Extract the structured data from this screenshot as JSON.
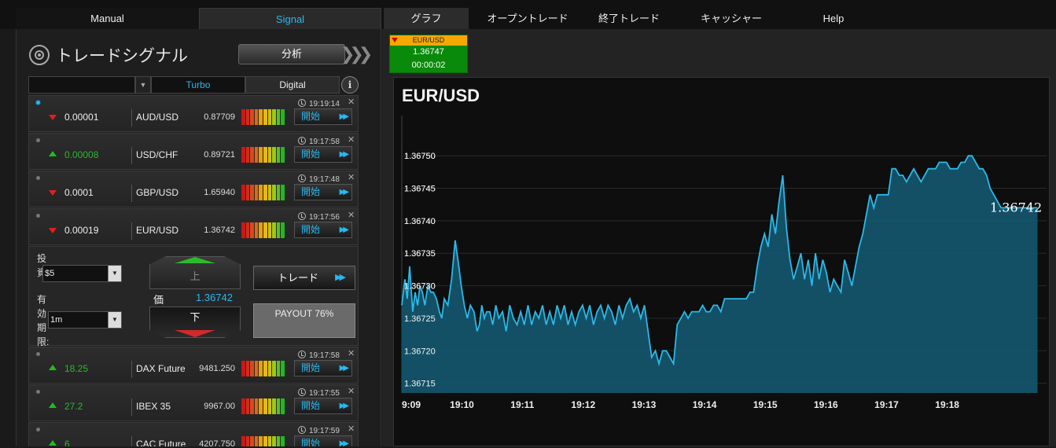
{
  "top_tabs": {
    "manual": "Manual",
    "signal": "Signal",
    "graph": "グラフ",
    "open_trades": "オープントレード",
    "closed_trades": "終了トレード",
    "cashier": "キャッシャー",
    "help": "Help"
  },
  "signals_panel": {
    "title": "トレードシグナル",
    "analysis_button": "分析",
    "filter": {
      "selected": "",
      "tab_turbo": "Turbo",
      "tab_digital": "Digital"
    },
    "open_label": "開始",
    "rows_before": [
      {
        "direction": "down",
        "change": "0.00001",
        "asset": "AUD/USD",
        "price": "0.87709",
        "time": "19:19:14",
        "active": true
      },
      {
        "direction": "up",
        "change": "0.00008",
        "asset": "USD/CHF",
        "price": "0.89721",
        "time": "19:17:58",
        "active": false
      },
      {
        "direction": "down",
        "change": "0.0001",
        "asset": "GBP/USD",
        "price": "1.65940",
        "time": "19:17:48",
        "active": false
      },
      {
        "direction": "down",
        "change": "0.00019",
        "asset": "EUR/USD",
        "price": "1.36742",
        "time": "19:17:56",
        "active": false
      }
    ],
    "rows_after": [
      {
        "direction": "up",
        "change": "18.25",
        "asset": "DAX Future",
        "price": "9481.250",
        "time": "19:17:58",
        "active": false
      },
      {
        "direction": "up",
        "change": "27.2",
        "asset": "IBEX 35",
        "price": "9967.00",
        "time": "19:17:55",
        "active": false
      },
      {
        "direction": "up",
        "change": "6",
        "asset": "CAC Future",
        "price": "4207.750",
        "time": "19:17:59",
        "active": false
      }
    ],
    "trade": {
      "invest_label": "投資:",
      "invest_value": "$5",
      "expiry_label": "有効期限:",
      "expiry_value": "1m",
      "up_label": "上",
      "down_label": "下",
      "price_label": "価",
      "price_value": "1.36742",
      "trade_button": "トレード",
      "payout": "PAYOUT 76%"
    }
  },
  "mini_card": {
    "asset": "EUR/USD",
    "price": "1.36747",
    "timer": "00:00:02",
    "direction": "down"
  },
  "colors": {
    "accent": "#29b7ef",
    "up": "#2bb82b",
    "down": "#d22222",
    "chart_fill": "#14546b",
    "chart_line": "#2cb8e8"
  },
  "chart_data": {
    "type": "area",
    "title": "EUR/USD",
    "current_value": "1.36742",
    "y_ticks": [
      "1.36750",
      "1.36745",
      "1.36740",
      "1.36735",
      "1.36730",
      "1.36725",
      "1.36720",
      "1.36715"
    ],
    "x_ticks": [
      "9:09",
      "19:10",
      "19:11",
      "19:12",
      "19:13",
      "19:14",
      "19:15",
      "19:16",
      "19:17",
      "19:18"
    ],
    "ylim": [
      1.367135,
      1.367545
    ],
    "x_range": [
      9.0,
      19.5
    ],
    "grid": true,
    "x": [
      9.0,
      9.05,
      9.09,
      9.13,
      9.18,
      9.22,
      9.26,
      9.3,
      9.34,
      9.38,
      9.43,
      9.48,
      9.52,
      9.57,
      9.62,
      9.66,
      9.7,
      9.76,
      9.82,
      9.88,
      9.94,
      9.98,
      10.03,
      10.08,
      10.13,
      10.19,
      10.24,
      10.28,
      10.32,
      10.36,
      10.4,
      10.45,
      10.5,
      10.55,
      10.6,
      10.66,
      10.72,
      10.78,
      10.84,
      10.9,
      10.96,
      11.02,
      11.08,
      11.14,
      11.2,
      11.26,
      11.32,
      11.38,
      11.44,
      11.5,
      11.56,
      11.62,
      11.68,
      11.74,
      11.8,
      11.86,
      11.92,
      11.98,
      12.04,
      12.1,
      12.16,
      12.22,
      12.28,
      12.34,
      12.4,
      12.46,
      12.52,
      12.58,
      12.64,
      12.7,
      12.76,
      12.82,
      12.88,
      12.94,
      13.0,
      13.06,
      13.12,
      13.18,
      13.24,
      13.3,
      13.36,
      13.42,
      13.48,
      13.54,
      13.6,
      13.66,
      13.72,
      13.78,
      13.84,
      13.9,
      13.96,
      14.02,
      14.08,
      14.14,
      14.2,
      14.26,
      14.32,
      14.38,
      14.44,
      14.5,
      14.56,
      14.62,
      14.68,
      14.74,
      14.8,
      14.86,
      14.92,
      14.98,
      15.04,
      15.1,
      15.16,
      15.22,
      15.28,
      15.34,
      15.4,
      15.46,
      15.52,
      15.58,
      15.64,
      15.7,
      15.76,
      15.82,
      15.88,
      15.94,
      16.0,
      16.06,
      16.12,
      16.18,
      16.24,
      16.3,
      16.36,
      16.42,
      16.48,
      16.54,
      16.6,
      16.66,
      16.72,
      16.78,
      16.84,
      16.9,
      16.96,
      17.02,
      17.08,
      17.14,
      17.2,
      17.26,
      17.32,
      17.38,
      17.44,
      17.5,
      17.56,
      17.62,
      17.68,
      17.74,
      17.8,
      17.86,
      17.92,
      17.98,
      18.04,
      18.1,
      18.16,
      18.22,
      18.28,
      18.34,
      18.4,
      18.46,
      18.52,
      18.58,
      18.64,
      18.7,
      18.76,
      18.82,
      18.88,
      18.94,
      19.0,
      19.06,
      19.12,
      19.18,
      19.24,
      19.3,
      19.36,
      19.42,
      19.48
    ],
    "values": [
      1.36727,
      1.36731,
      1.36728,
      1.36733,
      1.36726,
      1.36729,
      1.36727,
      1.3673,
      1.36729,
      1.36727,
      1.3673,
      1.36729,
      1.36729,
      1.36728,
      1.36726,
      1.36725,
      1.36728,
      1.36727,
      1.36731,
      1.36737,
      1.36733,
      1.3673,
      1.36727,
      1.36725,
      1.36727,
      1.36726,
      1.36723,
      1.36724,
      1.36727,
      1.36725,
      1.36726,
      1.36726,
      1.36724,
      1.36727,
      1.36725,
      1.36726,
      1.36723,
      1.36727,
      1.36725,
      1.36724,
      1.36726,
      1.36724,
      1.36727,
      1.36724,
      1.36726,
      1.36725,
      1.36727,
      1.36724,
      1.36726,
      1.36724,
      1.36727,
      1.36725,
      1.36727,
      1.36724,
      1.36726,
      1.36724,
      1.36726,
      1.36727,
      1.36725,
      1.36727,
      1.36724,
      1.36726,
      1.36727,
      1.36725,
      1.36727,
      1.36726,
      1.36724,
      1.36727,
      1.36725,
      1.36727,
      1.36728,
      1.36726,
      1.36727,
      1.36725,
      1.36727,
      1.36723,
      1.36719,
      1.3672,
      1.36718,
      1.3672,
      1.3672,
      1.36719,
      1.36718,
      1.36724,
      1.36725,
      1.36726,
      1.36725,
      1.36726,
      1.36726,
      1.36726,
      1.36727,
      1.36726,
      1.36726,
      1.36727,
      1.36727,
      1.36726,
      1.36728,
      1.36728,
      1.36728,
      1.36728,
      1.36728,
      1.36728,
      1.36728,
      1.36729,
      1.36729,
      1.36733,
      1.36736,
      1.36738,
      1.36736,
      1.36741,
      1.36738,
      1.36743,
      1.36747,
      1.36739,
      1.36734,
      1.36731,
      1.36733,
      1.36735,
      1.36731,
      1.36734,
      1.3673,
      1.36735,
      1.36731,
      1.36734,
      1.36732,
      1.36729,
      1.36731,
      1.3673,
      1.36729,
      1.36734,
      1.36732,
      1.3673,
      1.36733,
      1.36736,
      1.36738,
      1.36741,
      1.36744,
      1.36742,
      1.36744,
      1.36744,
      1.36744,
      1.36744,
      1.36748,
      1.36748,
      1.36747,
      1.36747,
      1.36746,
      1.36747,
      1.36748,
      1.36747,
      1.36746,
      1.36747,
      1.36748,
      1.36748,
      1.36748,
      1.36749,
      1.36749,
      1.36749,
      1.36748,
      1.36748,
      1.36748,
      1.36749,
      1.36749,
      1.3675,
      1.3675,
      1.36749,
      1.36748,
      1.36748,
      1.36747,
      1.36745,
      1.36744,
      1.36743,
      1.36742,
      1.36742,
      1.36742,
      1.36742,
      1.36742,
      1.36742,
      1.36742,
      1.36742,
      1.36742,
      1.36742,
      1.36742,
      1.36742
    ]
  }
}
